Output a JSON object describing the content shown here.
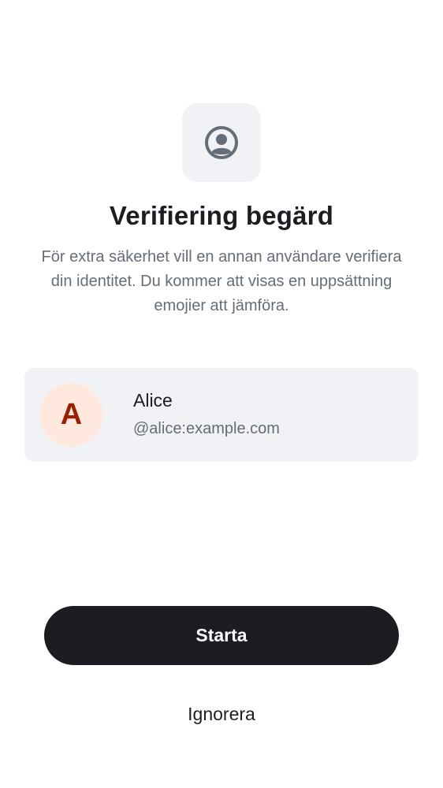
{
  "header": {
    "icon": "user-profile-icon",
    "title": "Verifiering begärd",
    "description": "För extra säkerhet vill en annan användare verifiera din identitet. Du kommer att visas en uppsättning emojier att jämföra."
  },
  "user": {
    "avatar_initial": "A",
    "name": "Alice",
    "id": "@alice:example.com"
  },
  "actions": {
    "start_label": "Starta",
    "ignore_label": "Ignorera"
  },
  "colors": {
    "background": "#ffffff",
    "surface": "#f0f2f5",
    "primary": "#1b1d22",
    "secondary_text": "#656d77",
    "avatar_bg": "#ffe9de",
    "avatar_text": "#9b2002"
  }
}
